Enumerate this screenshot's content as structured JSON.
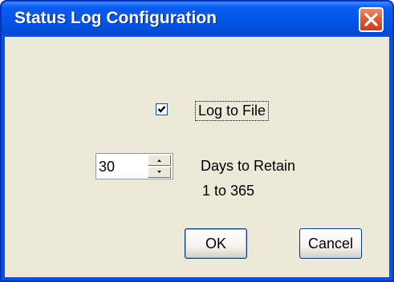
{
  "window": {
    "title": "Status Log Configuration",
    "close_icon": "close-x-icon"
  },
  "dialog": {
    "log_to_file": {
      "label": "Log to File",
      "checked": true
    },
    "days_to_retain": {
      "value": "30",
      "label": "Days to Retain",
      "range_label": "1 to 365"
    },
    "buttons": {
      "ok_label": "OK",
      "cancel_label": "Cancel"
    }
  },
  "colors": {
    "titlebar": "#0455e6",
    "dialog_background": "#ece9d8",
    "close_button": "#e05a35"
  }
}
